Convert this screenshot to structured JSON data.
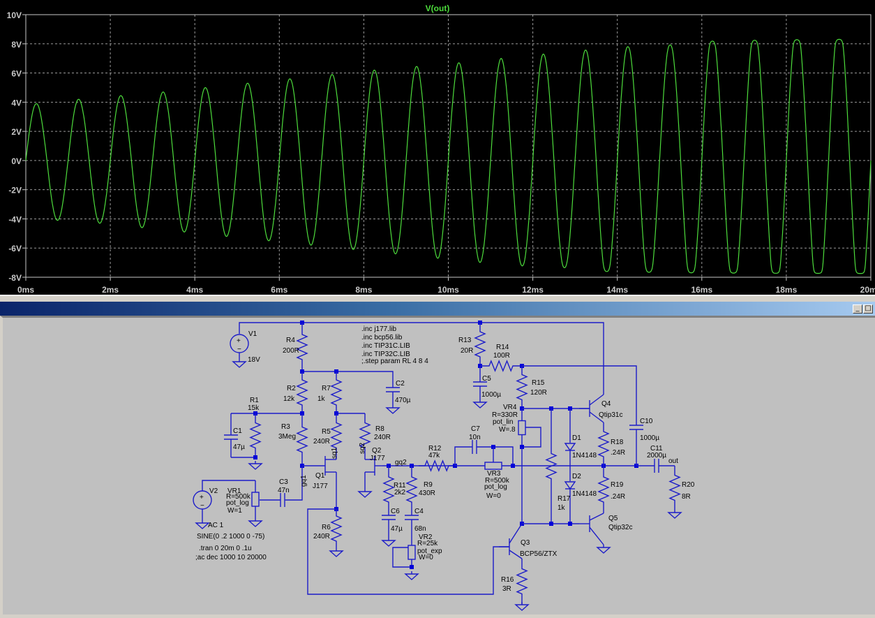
{
  "plot": {
    "trace_name": "V(out)",
    "trace_color": "#4ddc3c",
    "background": "#000000"
  },
  "chart_data": {
    "type": "line",
    "title": "V(out)",
    "xlabel": "",
    "ylabel": "",
    "xlim": [
      0,
      20
    ],
    "ylim": [
      -8,
      10
    ],
    "x_unit": "ms",
    "y_unit": "V",
    "xticks": [
      "0ms",
      "2ms",
      "4ms",
      "6ms",
      "8ms",
      "10ms",
      "12ms",
      "14ms",
      "16ms",
      "18ms",
      "20ms"
    ],
    "yticks": [
      "10V",
      "8V",
      "6V",
      "4V",
      "2V",
      "0V",
      "-2V",
      "-4V",
      "-6V",
      "-8V"
    ],
    "grid": true,
    "series": [
      {
        "name": "V(out)",
        "frequency_hz": 1000,
        "positive_peaks_v": [
          3.9,
          4.2,
          4.45,
          4.7,
          5.0,
          5.3,
          5.6,
          5.9,
          6.2,
          6.45,
          6.7,
          7.0,
          7.3,
          7.6,
          7.9,
          8.1,
          8.3,
          8.3,
          8.3,
          8.3
        ],
        "negative_peaks_v": [
          -4.1,
          -4.3,
          -4.6,
          -4.9,
          -5.2,
          -5.5,
          -5.8,
          -6.1,
          -6.4,
          -6.7,
          -7.0,
          -7.3,
          -7.5,
          -7.7,
          -7.7,
          -7.7,
          -7.75,
          -7.75,
          -7.75,
          -7.75
        ],
        "clip_levels_v": [
          8.35,
          -7.75
        ]
      }
    ]
  },
  "window": {
    "minimize_label": "_",
    "maximize_label": "□",
    "wire_color": "#1c1cc8",
    "canvas_color": "#c0c0c0"
  },
  "schematic": {
    "V1": [
      "V1",
      "18V"
    ],
    "V2": [
      "V2",
      "AC 1"
    ],
    "R1": [
      "R1",
      "15k"
    ],
    "R2": [
      "R2",
      "12k"
    ],
    "R3": [
      "R3",
      "3Meg"
    ],
    "R4": [
      "R4",
      "200R"
    ],
    "R5": [
      "R5",
      "240R"
    ],
    "R6": [
      "R6",
      "240R"
    ],
    "R7": [
      "R7",
      "1k"
    ],
    "R8": [
      "R8",
      "240R"
    ],
    "R9": [
      "R9",
      "430R"
    ],
    "R11": [
      "R11",
      "2k2"
    ],
    "R12": [
      "R12",
      "47k"
    ],
    "R13": [
      "R13",
      "20R"
    ],
    "R14": [
      "R14",
      "100R"
    ],
    "R15": [
      "R15",
      "120R"
    ],
    "R16": [
      "R16",
      "3R"
    ],
    "R17": [
      "R17",
      "1k"
    ],
    "R18": [
      "R18",
      ".24R"
    ],
    "R19": [
      "R19",
      ".24R"
    ],
    "R20": [
      "R20",
      "8R"
    ],
    "C1": [
      "C1",
      "47µ"
    ],
    "C2": [
      "C2",
      "470µ"
    ],
    "C3": [
      "C3",
      "47n"
    ],
    "C4": [
      "C4",
      "68n"
    ],
    "C5": [
      "C5",
      "1000µ"
    ],
    "C6": [
      "C6",
      "47µ"
    ],
    "C7": [
      "C7",
      "10n"
    ],
    "C10": [
      "C10",
      "1000µ"
    ],
    "C11": [
      "C11",
      "2000µ"
    ],
    "VR1": [
      "VR1",
      "R=500k",
      "pot_log",
      "W=1"
    ],
    "VR2": [
      "VR2",
      "R=25k",
      "pot_exp",
      "W=0"
    ],
    "VR3": [
      "VR3",
      "R=500k",
      "pot_log",
      "W=0"
    ],
    "VR4": [
      "VR4",
      "R=330R",
      "pot_lin",
      "W=.8"
    ],
    "Q1": [
      "Q1",
      "J177"
    ],
    "Q2": [
      "Q2",
      "J177"
    ],
    "Q3": [
      "Q3",
      "BCP56/ZTX"
    ],
    "Q4": [
      "Q4",
      "Qtip31c"
    ],
    "Q5": [
      "Q5",
      "Qtip32c"
    ],
    "D1": [
      "D1",
      "1N4148"
    ],
    "D2": [
      "D2",
      "1N4148"
    ],
    "nets": [
      "gq1",
      "sq1",
      "sq2",
      "gq2",
      "out"
    ],
    "directives": [
      ".inc j177.lib",
      ".inc bcp56.lib",
      ".inc TIP31C.LIB",
      ".inc TIP32C.LIB",
      ";.step param RL 4 8 4"
    ],
    "source_spec": [
      "SINE(0 .2 1000 0 -75)",
      ".tran 0 20m 0 .1u",
      ";ac dec 1000 10 20000"
    ]
  }
}
